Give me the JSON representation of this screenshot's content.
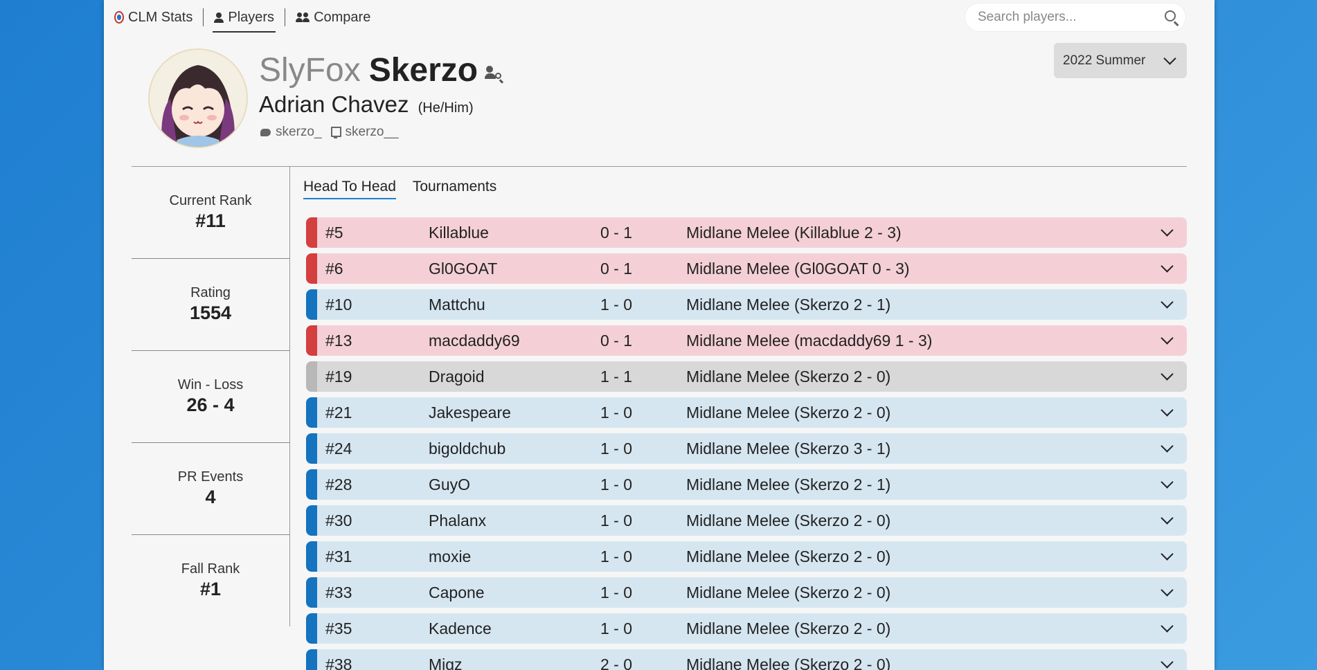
{
  "nav": {
    "brand": "CLM Stats",
    "players": "Players",
    "compare": "Compare"
  },
  "search": {
    "placeholder": "Search players..."
  },
  "season": {
    "selected": "2022 Summer"
  },
  "profile": {
    "sponsor": "SlyFox",
    "tag": "Skerzo",
    "real_name": "Adrian Chavez",
    "pronouns": "(He/Him)",
    "twitter": "skerzo_",
    "twitch": "skerzo__"
  },
  "stats": [
    {
      "label": "Current Rank",
      "value": "#11"
    },
    {
      "label": "Rating",
      "value": "1554"
    },
    {
      "label": "Win - Loss",
      "value": "26 - 4"
    },
    {
      "label": "PR Events",
      "value": "4"
    },
    {
      "label": "Fall Rank",
      "value": "#1"
    }
  ],
  "tabs": [
    "Head To Head",
    "Tournaments"
  ],
  "colors": {
    "win_bar": "#1573c0",
    "win_bg": "#d6e6f1",
    "loss_bar": "#d43f3f",
    "loss_bg": "#f4d0d6",
    "draw_bar": "#b8b8b8",
    "draw_bg": "#d8d8d8"
  },
  "head_to_head": [
    {
      "result": "loss",
      "rank": "#5",
      "name": "Killablue",
      "record": "0 - 1",
      "event": "Midlane Melee (Killablue 2 - 3)"
    },
    {
      "result": "loss",
      "rank": "#6",
      "name": "Gl0GOAT",
      "record": "0 - 1",
      "event": "Midlane Melee (Gl0GOAT 0 - 3)"
    },
    {
      "result": "win",
      "rank": "#10",
      "name": "Mattchu",
      "record": "1 - 0",
      "event": "Midlane Melee (Skerzo 2 - 1)"
    },
    {
      "result": "loss",
      "rank": "#13",
      "name": "macdaddy69",
      "record": "0 - 1",
      "event": "Midlane Melee (macdaddy69 1 - 3)"
    },
    {
      "result": "draw",
      "rank": "#19",
      "name": "Dragoid",
      "record": "1 - 1",
      "event": "Midlane Melee (Skerzo 2 - 0)"
    },
    {
      "result": "win",
      "rank": "#21",
      "name": "Jakespeare",
      "record": "1 - 0",
      "event": "Midlane Melee (Skerzo 2 - 0)"
    },
    {
      "result": "win",
      "rank": "#24",
      "name": "bigoldchub",
      "record": "1 - 0",
      "event": "Midlane Melee (Skerzo 3 - 1)"
    },
    {
      "result": "win",
      "rank": "#28",
      "name": "GuyO",
      "record": "1 - 0",
      "event": "Midlane Melee (Skerzo 2 - 1)"
    },
    {
      "result": "win",
      "rank": "#30",
      "name": "Phalanx",
      "record": "1 - 0",
      "event": "Midlane Melee (Skerzo 2 - 0)"
    },
    {
      "result": "win",
      "rank": "#31",
      "name": "moxie",
      "record": "1 - 0",
      "event": "Midlane Melee (Skerzo 2 - 0)"
    },
    {
      "result": "win",
      "rank": "#33",
      "name": "Capone",
      "record": "1 - 0",
      "event": "Midlane Melee (Skerzo 2 - 0)"
    },
    {
      "result": "win",
      "rank": "#35",
      "name": "Kadence",
      "record": "1 - 0",
      "event": "Midlane Melee (Skerzo 2 - 0)"
    },
    {
      "result": "win",
      "rank": "#38",
      "name": "Migz",
      "record": "2 - 0",
      "event": "Midlane Melee (Skerzo 2 - 0)"
    }
  ]
}
